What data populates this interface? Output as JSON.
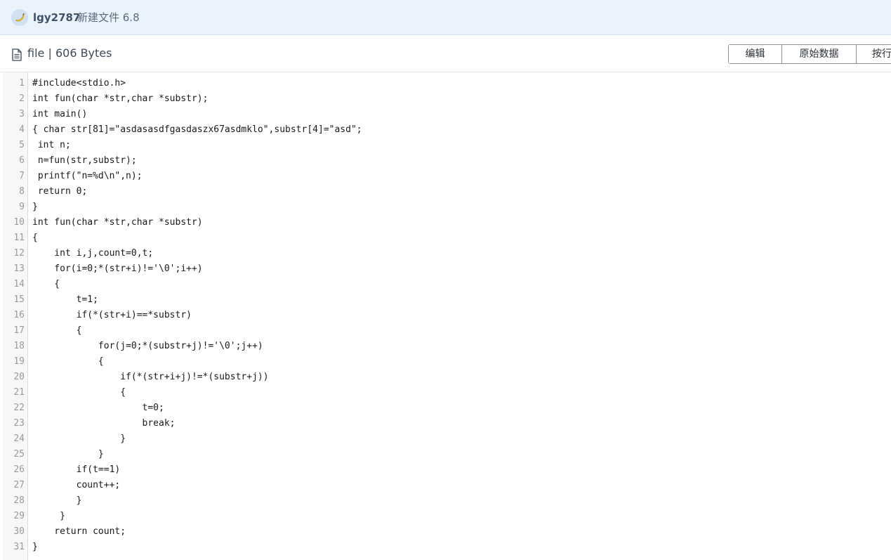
{
  "header": {
    "user": "lgy2787",
    "repo": "新建文件 6.8"
  },
  "file": {
    "name": "file",
    "separator": "|",
    "size": "606 Bytes"
  },
  "toolbar": {
    "edit_label": "编辑",
    "raw_label": "原始数据",
    "wrap_label": "按行"
  },
  "code": {
    "lines": [
      "#include<stdio.h>",
      "int fun(char *str,char *substr);",
      "int main()",
      "{ char str[81]=\"asdasasdfgasdaszx67asdmklo\",substr[4]=\"asd\";",
      " int n;",
      " n=fun(str,substr);",
      " printf(\"n=%d\\n\",n);",
      " return 0;",
      "}",
      "int fun(char *str,char *substr)",
      "{",
      "    int i,j,count=0,t;",
      "    for(i=0;*(str+i)!='\\0';i++)",
      "    {",
      "        t=1;",
      "        if(*(str+i)==*substr)",
      "        {",
      "            for(j=0;*(substr+j)!='\\0';j++)",
      "            {",
      "                if(*(str+i+j)!=*(substr+j))",
      "                {",
      "                    t=0;",
      "                    break;",
      "                }",
      "            }",
      "        if(t==1)",
      "        count++;",
      "        }",
      "     }",
      "    return count;",
      "}"
    ]
  }
}
